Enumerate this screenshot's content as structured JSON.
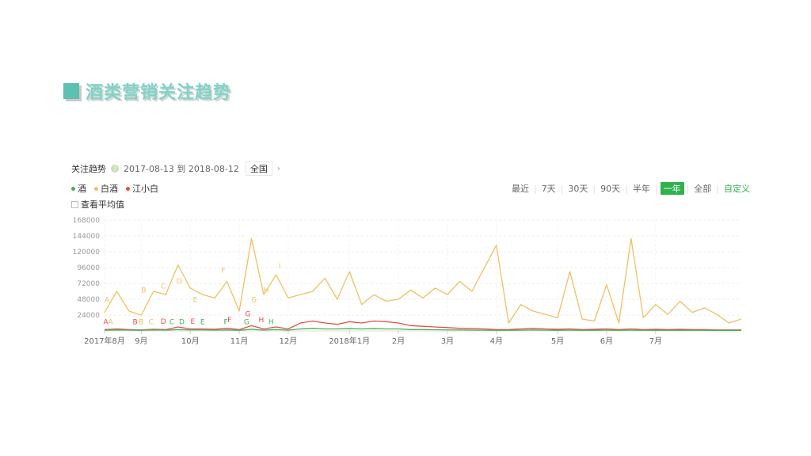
{
  "slide": {
    "title": "酒类营销关注趋势"
  },
  "header": {
    "label": "关注趋势",
    "help_icon": "question-icon",
    "date_range": "2017-08-13 到 2018-08-12",
    "region": "全国",
    "region_chevron": "›"
  },
  "legend": [
    {
      "name": "酒",
      "color": "#4caf50"
    },
    {
      "name": "白酒",
      "color": "#f0c060"
    },
    {
      "name": "江小白",
      "color": "#e05050"
    }
  ],
  "average_checkbox": {
    "label": "查看平均值",
    "checked": false
  },
  "range": {
    "prefix": "最近",
    "options": [
      "7天",
      "30天",
      "90天",
      "半年",
      "一年",
      "全部",
      "自定义"
    ],
    "active": "一年"
  },
  "chart_data": {
    "type": "line",
    "ylim": [
      0,
      168000
    ],
    "yticks": [
      24000,
      48000,
      72000,
      96000,
      120000,
      144000,
      168000
    ],
    "x_tick_labels": [
      "2017年8月",
      "9月",
      "10月",
      "11月",
      "12月",
      "2018年1月",
      "2月",
      "3月",
      "4月",
      "5月",
      "6月",
      "7月"
    ],
    "x_tick_weeks": [
      0,
      3,
      7,
      11,
      15,
      20,
      24,
      28,
      32,
      37,
      41,
      45
    ],
    "weeks": 52,
    "series": [
      {
        "name": "白酒",
        "color": "#f0c060",
        "values": [
          28000,
          60000,
          30000,
          24000,
          60000,
          55000,
          100000,
          65000,
          55000,
          50000,
          75000,
          30000,
          140000,
          55000,
          85000,
          50000,
          55000,
          60000,
          80000,
          48000,
          90000,
          40000,
          55000,
          45000,
          48000,
          62000,
          50000,
          65000,
          55000,
          75000,
          60000,
          95000,
          130000,
          12000,
          40000,
          30000,
          25000,
          20000,
          90000,
          18000,
          15000,
          70000,
          12000,
          140000,
          20000,
          40000,
          25000,
          45000,
          28000,
          35000,
          25000,
          12000,
          18000
        ]
      },
      {
        "name": "江小白",
        "color": "#e05050",
        "values": [
          2000,
          3000,
          2000,
          1500,
          2500,
          2000,
          6000,
          3000,
          3000,
          2500,
          4000,
          2000,
          8000,
          3000,
          6000,
          3000,
          12000,
          15000,
          12000,
          10000,
          14000,
          12000,
          15000,
          14000,
          12000,
          8000,
          7000,
          6000,
          5000,
          4000,
          3500,
          3000,
          2000,
          2000,
          3000,
          4000,
          3000,
          2500,
          3000,
          2000,
          2500,
          3000,
          2000,
          3000,
          2000,
          2500,
          2000,
          2500,
          2000,
          2000,
          1500,
          1500,
          1500
        ]
      },
      {
        "name": "酒",
        "color": "#4caf50",
        "values": [
          1000,
          1500,
          1200,
          1000,
          1500,
          1200,
          2000,
          1500,
          1500,
          1200,
          1500,
          1000,
          2500,
          1200,
          2000,
          1200,
          3000,
          4000,
          3000,
          3000,
          3500,
          3000,
          3500,
          3000,
          3000,
          2000,
          2000,
          1800,
          1500,
          1500,
          1200,
          1200,
          1000,
          1000,
          1200,
          1500,
          1200,
          1000,
          1200,
          1000,
          1000,
          1200,
          1000,
          1200,
          1000,
          1000,
          1000,
          1000,
          1000,
          1000,
          800,
          800,
          800
        ]
      }
    ],
    "annotations": [
      {
        "label": "A",
        "week": 0.2,
        "y": 44000,
        "color": "#f0c060"
      },
      {
        "label": "B",
        "week": 3.2,
        "y": 58000,
        "color": "#f0c060"
      },
      {
        "label": "C",
        "week": 4.8,
        "y": 64000,
        "color": "#f0c060"
      },
      {
        "label": "D",
        "week": 6.1,
        "y": 72000,
        "color": "#f0c060"
      },
      {
        "label": "E",
        "week": 7.4,
        "y": 44000,
        "color": "#f0c060"
      },
      {
        "label": "F",
        "week": 9.7,
        "y": 88000,
        "color": "#f0c060"
      },
      {
        "label": "G",
        "week": 12.2,
        "y": 44000,
        "color": "#f0c060"
      },
      {
        "label": "H",
        "week": 13.2,
        "y": 58000,
        "color": "#f0c060"
      },
      {
        "label": "I",
        "week": 14.3,
        "y": 95000,
        "color": "#f0c060"
      },
      {
        "label": "G",
        "week": 11.7,
        "y": 22000,
        "color": "#e05050"
      },
      {
        "label": "H",
        "week": 12.8,
        "y": 13000,
        "color": "#e05050"
      },
      {
        "label": "F",
        "week": 10.2,
        "y": 13000,
        "color": "#e05050"
      },
      {
        "label": "E",
        "week": 7.2,
        "y": 11000,
        "color": "#e05050"
      },
      {
        "label": "D",
        "week": 4.8,
        "y": 11000,
        "color": "#e05050"
      },
      {
        "label": "B",
        "week": 2.5,
        "y": 10000,
        "color": "#e05050"
      },
      {
        "label": "A",
        "week": 0.1,
        "y": 10000,
        "color": "#e05050"
      },
      {
        "label": "A",
        "week": 0.5,
        "y": 10000,
        "color": "#f0c060"
      },
      {
        "label": "B",
        "week": 3.0,
        "y": 10000,
        "color": "#f0c060"
      },
      {
        "label": "C",
        "week": 3.8,
        "y": 10000,
        "color": "#f0c060"
      },
      {
        "label": "C",
        "week": 5.5,
        "y": 10000,
        "color": "#4caf50"
      },
      {
        "label": "D",
        "week": 6.3,
        "y": 10000,
        "color": "#4caf50"
      },
      {
        "label": "E",
        "week": 8.0,
        "y": 10000,
        "color": "#4caf50"
      },
      {
        "label": "F",
        "week": 9.9,
        "y": 10000,
        "color": "#4caf50"
      },
      {
        "label": "G",
        "week": 11.6,
        "y": 10000,
        "color": "#4caf50"
      },
      {
        "label": "H",
        "week": 13.6,
        "y": 10000,
        "color": "#4caf50"
      }
    ]
  }
}
